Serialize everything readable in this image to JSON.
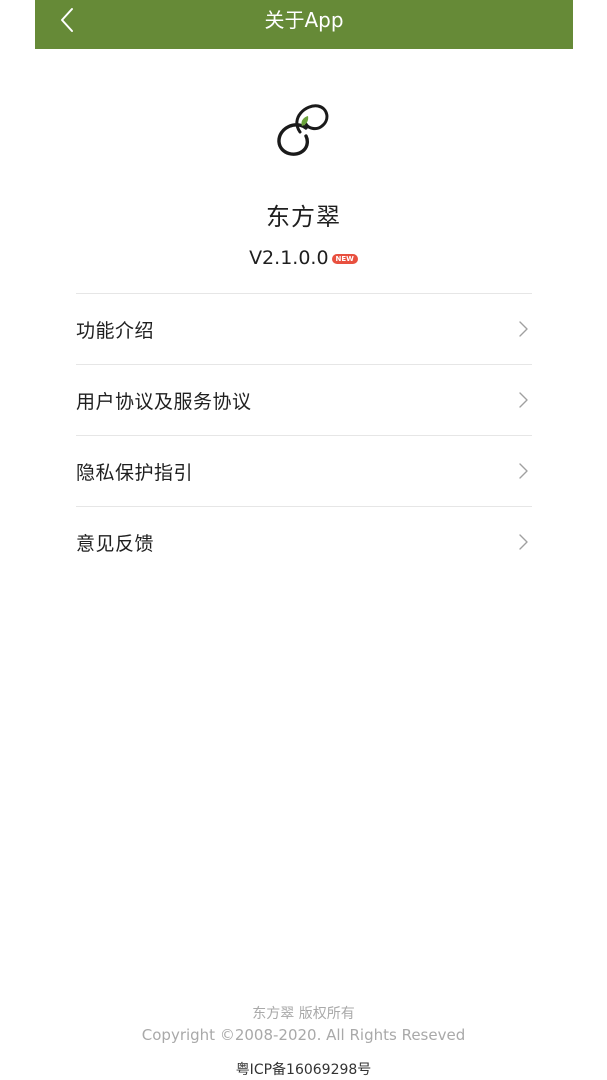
{
  "header": {
    "title": "关于App",
    "back_icon": "chevron-left-icon",
    "background_color": "#668a37"
  },
  "app": {
    "logo_icon": "dongfangcui-logo",
    "name": "东方翠",
    "version": "V2.1.0.0",
    "badge": "NEW",
    "badge_color": "#e8503f"
  },
  "menu": {
    "items": [
      {
        "label": "功能介绍",
        "icon": "chevron-right-icon"
      },
      {
        "label": "用户协议及服务协议",
        "icon": "chevron-right-icon"
      },
      {
        "label": "隐私保护指引",
        "icon": "chevron-right-icon"
      },
      {
        "label": "意见反馈",
        "icon": "chevron-right-icon"
      }
    ]
  },
  "footer": {
    "owner": "东方翠 版权所有",
    "copyright": "Copyright ©2008-2020. All Rights Reseved",
    "icp": "粤ICP备16069298号"
  }
}
